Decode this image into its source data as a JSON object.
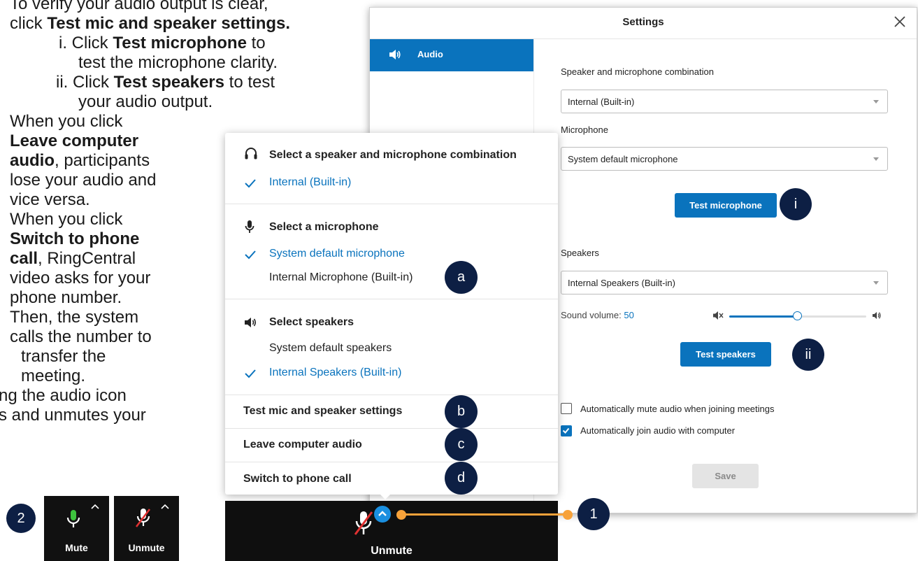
{
  "instructions": {
    "line1": "To verify your audio output is clear,",
    "line2_prefix": "click ",
    "line2_bold": "Test mic and speaker settings.",
    "item_i_prefix": "i.  Click ",
    "item_i_bold": "Test microphone",
    "item_i_suffix": " to",
    "item_i_cont": "test the microphone clarity.",
    "item_ii_prefix": "ii.  Click ",
    "item_ii_bold": "Test speakers",
    "item_ii_suffix": " to test",
    "item_ii_cont": "your audio output.",
    "leave_1": "When you click",
    "leave_2": "Leave computer",
    "leave_3_bold": "audio",
    "leave_3_rest": ", participants",
    "leave_4": "lose your audio and",
    "leave_5": "vice versa.",
    "switch_1": "When you click",
    "switch_2": "Switch to phone",
    "switch_3_bold": "call",
    "switch_3_rest": ", RingCentral",
    "switch_4": "video asks for your",
    "switch_5": "phone number.",
    "switch_6": "Then, the system",
    "switch_7": "calls the number to",
    "switch_8": "transfer the",
    "switch_9": "meeting.",
    "icon_1": "ng the audio icon",
    "icon_2": "s and unmutes your"
  },
  "settings": {
    "title": "Settings",
    "nav": {
      "audio_label": "Audio"
    },
    "speaker_mic_combo": {
      "label": "Speaker and microphone combination",
      "value": "Internal (Built-in)"
    },
    "microphone": {
      "label": "Microphone",
      "value": "System default microphone"
    },
    "test_microphone_label": "Test microphone",
    "speakers": {
      "label": "Speakers",
      "value": "Internal Speakers (Built-in)"
    },
    "sound_volume": {
      "label": "Sound volume: ",
      "value": "50",
      "level": 0.5
    },
    "test_speakers_label": "Test speakers",
    "auto_mute": {
      "label": "Automatically mute audio when joining meetings",
      "checked": false
    },
    "auto_join": {
      "label": "Automatically join audio with computer",
      "checked": true
    },
    "save_label": "Save"
  },
  "audio_menu": {
    "combo_heading": "Select a speaker and microphone combination",
    "combo_options": [
      {
        "label": "Internal (Built-in)",
        "selected": true
      }
    ],
    "mic_heading": "Select a microphone",
    "mic_options": [
      {
        "label": "System default microphone",
        "selected": true
      },
      {
        "label": "Internal Microphone (Built-in)",
        "selected": false
      }
    ],
    "speaker_heading": "Select speakers",
    "speaker_options": [
      {
        "label": "System default speakers",
        "selected": false
      },
      {
        "label": "Internal Speakers (Built-in)",
        "selected": true
      }
    ],
    "actions": {
      "test": "Test mic and speaker settings",
      "leave": "Leave computer audio",
      "switch": "Switch to phone call"
    }
  },
  "bottom_bar": {
    "label": "Unmute"
  },
  "tiles": {
    "mute_label": "Mute",
    "unmute_label": "Unmute"
  },
  "badges": {
    "i": "i",
    "ii": "ii",
    "a": "a",
    "b": "b",
    "c": "c",
    "d": "d",
    "one": "1",
    "two": "2"
  },
  "colors": {
    "accent": "#0a73bd",
    "badge": "#0d1f44",
    "callout": "#f7a23a",
    "mute_green": "#3ec33e",
    "muted_red": "#e03131"
  }
}
